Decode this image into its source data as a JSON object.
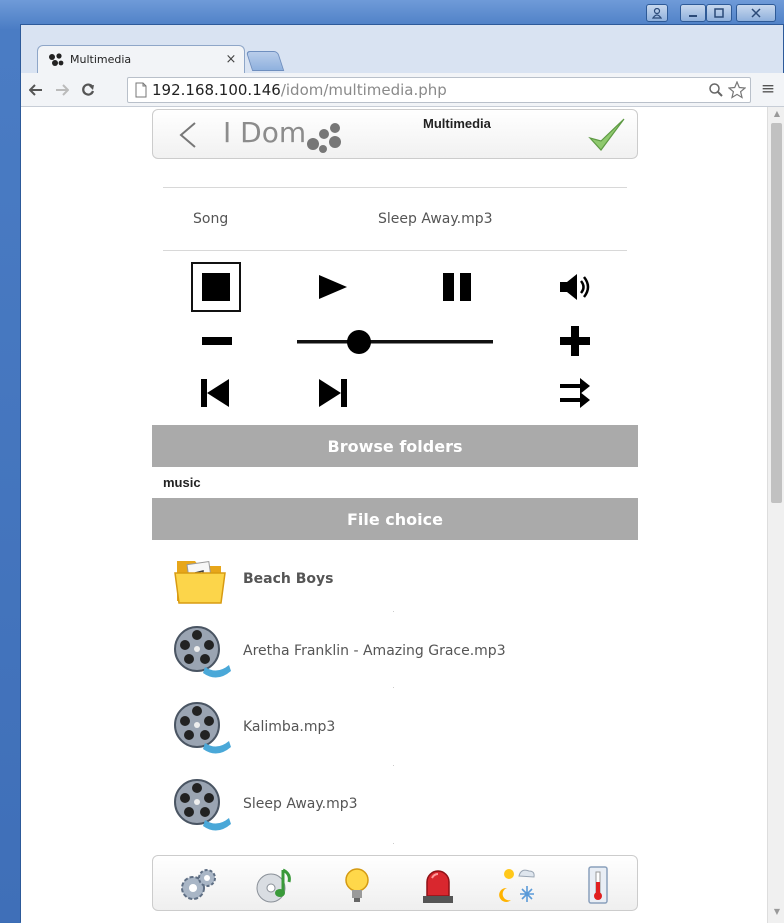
{
  "browser": {
    "tab_title": "Multimedia",
    "tab_close": "×",
    "url_host": "192.168.100.146",
    "url_path": "/idom/multimedia.php",
    "menu_glyph": "≡",
    "window_controls": [
      "user-icon",
      "minimize-icon",
      "maximize-icon",
      "close-icon"
    ]
  },
  "header": {
    "logo_text": "I Dom",
    "title": "Multimedia"
  },
  "now_playing": {
    "label": "Song",
    "value": "Sleep Away.mp3"
  },
  "volume": {
    "level": 0.29
  },
  "sections": {
    "browse": "Browse folders",
    "current_folder": "music",
    "file_choice": "File choice"
  },
  "files": [
    {
      "name": "Beach Boys",
      "type": "folder"
    },
    {
      "name": "Aretha Franklin - Amazing Grace.mp3",
      "type": "media"
    },
    {
      "name": "Kalimba.mp3",
      "type": "media"
    },
    {
      "name": "Sleep Away.mp3",
      "type": "media"
    }
  ],
  "footer_icons": [
    "settings-icon",
    "music-icon",
    "light-bulb-icon",
    "alarm-icon",
    "weather-icon",
    "thermometer-icon"
  ],
  "colors": {
    "section_bar": "#aaaaaa",
    "accent_check": "#6aa84f"
  }
}
